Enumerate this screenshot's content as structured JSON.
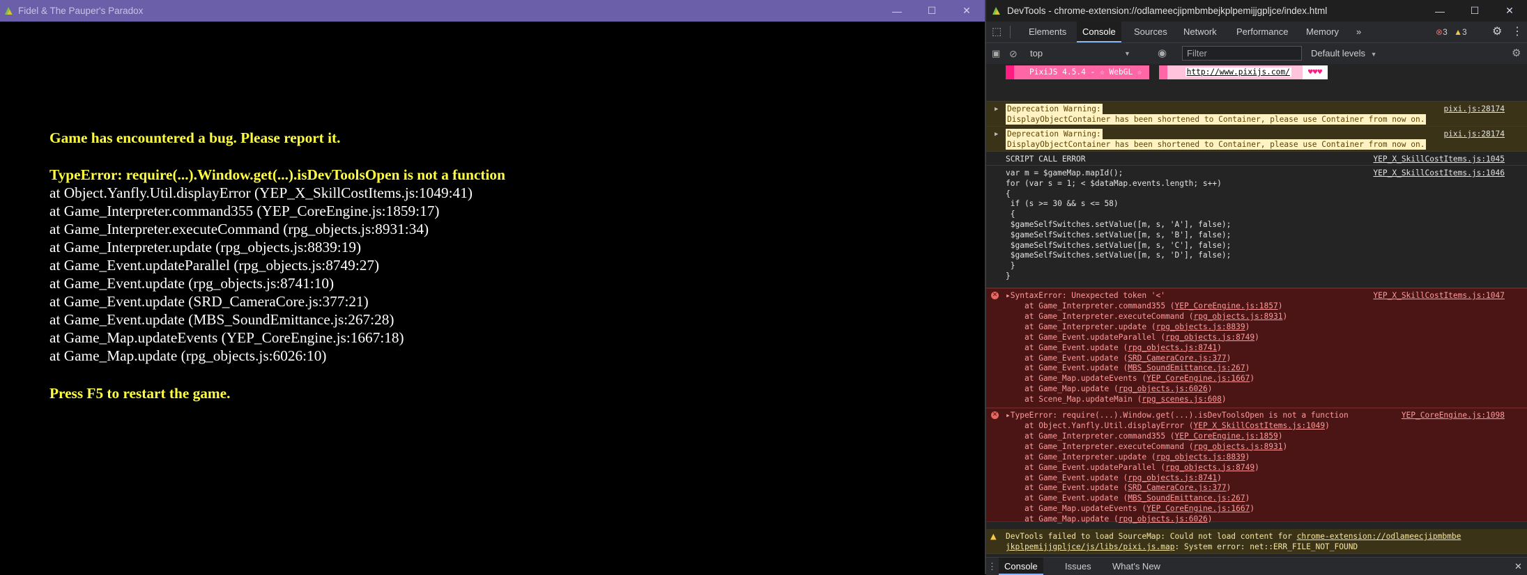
{
  "game": {
    "title": "Fidel & The Pauper's Paradox",
    "error_lines": [
      "Game has encountered a bug. Please report it.",
      "TypeError: require(...).Window.get(...).isDevToolsOpen is not a function",
      "at Object.Yanfly.Util.displayError (YEP_X_SkillCostItems.js:1049:41)",
      "at Game_Interpreter.command355 (YEP_CoreEngine.js:1859:17)",
      "at Game_Interpreter.executeCommand (rpg_objects.js:8931:34)",
      "at Game_Interpreter.update (rpg_objects.js:8839:19)",
      "at Game_Event.updateParallel (rpg_objects.js:8749:27)",
      "at Game_Event.update (rpg_objects.js:8741:10)",
      "at Game_Event.update (SRD_CameraCore.js:377:21)",
      "at Game_Event.update (MBS_SoundEmittance.js:267:28)",
      "at Game_Map.updateEvents (YEP_CoreEngine.js:1667:18)",
      "at Game_Map.update (rpg_objects.js:6026:10)",
      "Press F5 to restart the game."
    ]
  },
  "devtools": {
    "title": "DevTools - chrome-extension://odlameecjipmbmbejkplpemijjgpljce/index.html",
    "tabs": [
      "Elements",
      "Console",
      "Sources",
      "Network",
      "Performance",
      "Memory",
      "»"
    ],
    "error_count": "3",
    "warning_count": "3",
    "context": "top",
    "filter_placeholder": "Filter",
    "levels": "Default levels",
    "pixi": {
      "label": "PixiJS 4.5.4 - ☆ WebGL ☆",
      "url": "http://www.pixijs.com/",
      "hearts": "♥♥♥"
    },
    "warnings": [
      {
        "label": "Deprecation Warning:",
        "text": "DisplayObjectContainer has been shortened to Container, please use Container from now on.",
        "source": "pixi.js:28174"
      },
      {
        "label": "Deprecation Warning:",
        "text": "DisplayObjectContainer has been shortened to Container, please use Container from now on.",
        "source": "pixi.js:28174"
      }
    ],
    "script_error": {
      "label": "SCRIPT CALL ERROR",
      "source1": "YEP_X_SkillCostItems.js:1045",
      "source2": "YEP_X_SkillCostItems.js:1046",
      "code": [
        "var m = $gameMap.mapId();",
        "for (var s = 1; < $dataMap.events.length; s++)",
        "{",
        " if (s >= 30 && s <= 58)",
        " {",
        " $gameSelfSwitches.setValue([m, s, 'A'], false);",
        " $gameSelfSwitches.setValue([m, s, 'B'], false);",
        " $gameSelfSwitches.setValue([m, s, 'C'], false);",
        " $gameSelfSwitches.setValue([m, s, 'D'], false);",
        " }",
        "}"
      ]
    },
    "syntax_error": {
      "message": "▸SyntaxError: Unexpected token '<'",
      "source": "YEP_X_SkillCostItems.js:1047",
      "stack": [
        [
          "at Game_Interpreter.command355 (",
          "YEP_CoreEngine.js:1857",
          ")"
        ],
        [
          "at Game_Interpreter.executeCommand (",
          "rpg_objects.js:8931",
          ")"
        ],
        [
          "at Game_Interpreter.update (",
          "rpg_objects.js:8839",
          ")"
        ],
        [
          "at Game_Event.updateParallel (",
          "rpg_objects.js:8749",
          ")"
        ],
        [
          "at Game_Event.update (",
          "rpg_objects.js:8741",
          ")"
        ],
        [
          "at Game_Event.update (",
          "SRD_CameraCore.js:377",
          ")"
        ],
        [
          "at Game_Event.update (",
          "MBS_SoundEmittance.js:267",
          ")"
        ],
        [
          "at Game_Map.updateEvents (",
          "YEP_CoreEngine.js:1667",
          ")"
        ],
        [
          "at Game_Map.update (",
          "rpg_objects.js:6026",
          ")"
        ],
        [
          "at Scene_Map.updateMain (",
          "rpg_scenes.js:608",
          ")"
        ]
      ]
    },
    "type_error": {
      "message": "▸TypeError: require(...).Window.get(...).isDevToolsOpen is not a function",
      "source": "YEP_CoreEngine.js:1098",
      "stack": [
        [
          "at Object.Yanfly.Util.displayError (",
          "YEP_X_SkillCostItems.js:1049",
          ")"
        ],
        [
          "at Game_Interpreter.command355 (",
          "YEP_CoreEngine.js:1859",
          ")"
        ],
        [
          "at Game_Interpreter.executeCommand (",
          "rpg_objects.js:8931",
          ")"
        ],
        [
          "at Game_Interpreter.update (",
          "rpg_objects.js:8839",
          ")"
        ],
        [
          "at Game_Event.updateParallel (",
          "rpg_objects.js:8749",
          ")"
        ],
        [
          "at Game_Event.update (",
          "rpg_objects.js:8741",
          ")"
        ],
        [
          "at Game_Event.update (",
          "SRD_CameraCore.js:377",
          ")"
        ],
        [
          "at Game_Event.update (",
          "MBS_SoundEmittance.js:267",
          ")"
        ],
        [
          "at Game_Map.updateEvents (",
          "YEP_CoreEngine.js:1667",
          ")"
        ],
        [
          "at Game_Map.update (",
          "rpg_objects.js:6026",
          ")"
        ]
      ]
    },
    "sourcemap_warning": {
      "prefix": "DevTools failed to load SourceMap: Could not load content for ",
      "link1": "chrome-extension://odlameecjipmbmbe",
      "link2": "jkplpemijjgpljce/js/libs/pixi.js.map",
      "suffix": ": System error: net::ERR_FILE_NOT_FOUND"
    },
    "bottom_tabs": [
      "Console",
      "Issues",
      "What's New"
    ]
  }
}
